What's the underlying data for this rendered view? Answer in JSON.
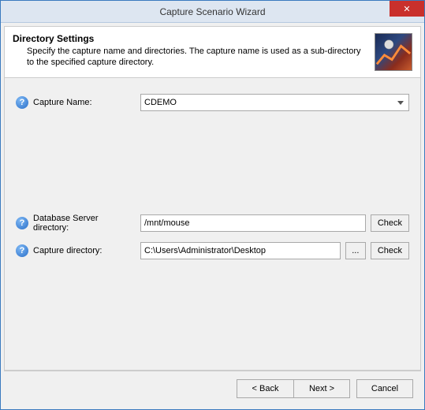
{
  "window": {
    "title": "Capture Scenario Wizard",
    "close_glyph": "✕"
  },
  "header": {
    "title": "Directory Settings",
    "description": "Specify the capture name and directories.  The capture name is used as a sub-directory to the specified capture directory."
  },
  "fields": {
    "capture_name": {
      "label": "Capture Name:",
      "value": "CDEMO"
    },
    "db_server_dir": {
      "label": "Database Server directory:",
      "value": "/mnt/mouse",
      "check_label": "Check"
    },
    "capture_dir": {
      "label": "Capture directory:",
      "value": "C:\\Users\\Administrator\\Desktop",
      "browse_label": "...",
      "check_label": "Check"
    }
  },
  "buttons": {
    "back": "< Back",
    "next": "Next >",
    "cancel": "Cancel"
  },
  "help_glyph": "?"
}
